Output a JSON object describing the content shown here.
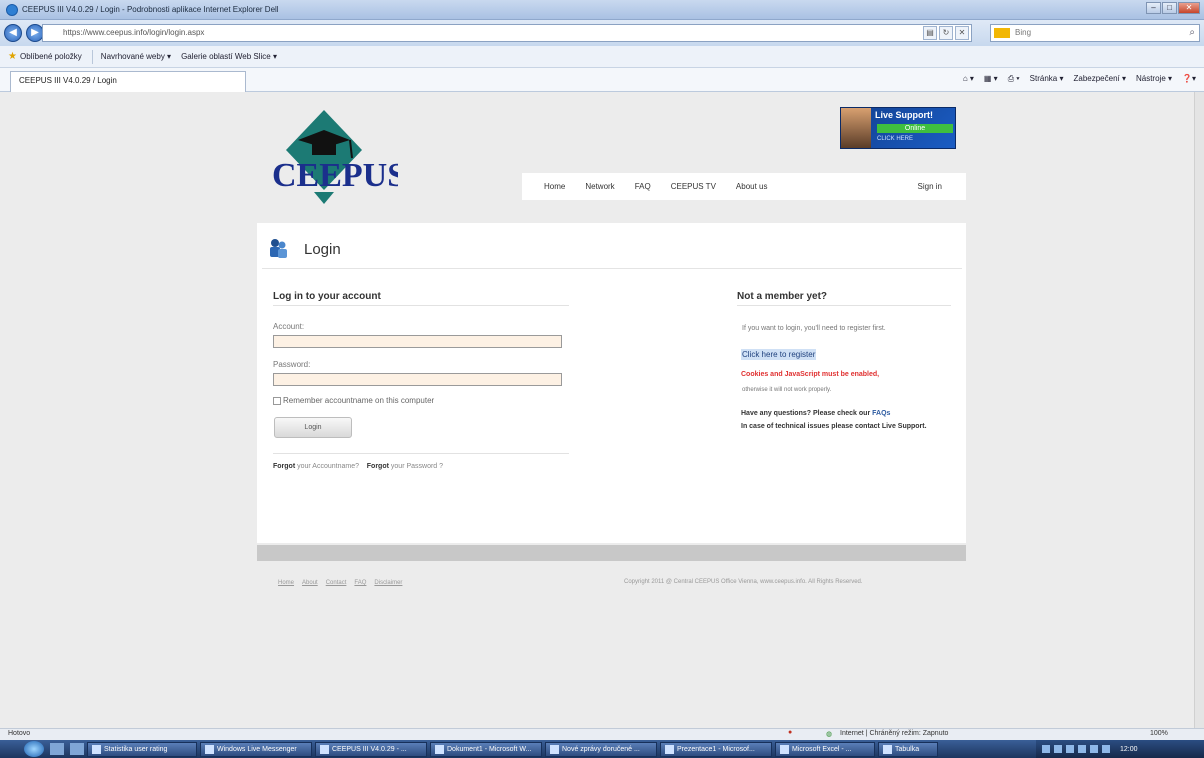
{
  "browser": {
    "window_title": "CEEPUS III V4.0.29 / Login - Podrobnosti aplikace Internet Explorer Dell",
    "url": "https://www.ceepus.info/login/login.aspx",
    "search_placeholder": "Bing",
    "favorites": {
      "label": "Oblíbené položky",
      "items": [
        "Navrhované weby ▾",
        "Galerie oblastí Web Slice ▾"
      ]
    },
    "tab_label": "CEEPUS III V4.0.29 / Login",
    "commands": [
      "Stránka ▾",
      "Zabezpečení ▾",
      "Nástroje ▾"
    ]
  },
  "header": {
    "logo_text": "CEEPUS",
    "live_support": {
      "title": "Live Support!",
      "status": "Online",
      "cta": "CLICK HERE"
    },
    "nav": [
      "Home",
      "Network",
      "FAQ",
      "CEEPUS TV",
      "About us"
    ],
    "sign_in": "Sign in"
  },
  "login": {
    "page_title": "Login",
    "section_title": "Log in to your account",
    "account_label": "Account:",
    "account_value": "",
    "password_label": "Password:",
    "password_value": "",
    "remember_label": "Remember accountname on this computer",
    "login_button": "Login",
    "forgot_account_bold": "Forgot",
    "forgot_account_text": "your Accountname?",
    "forgot_password_bold": "Forgot",
    "forgot_password_text": "your Password ?"
  },
  "register": {
    "section_title": "Not a member yet?",
    "intro": "If you want to login, you'll need to register first.",
    "link": "Click here to register",
    "cookie_warning": "Cookies and JavaScript must be enabled,",
    "cookie_note": "otherwise it will not work properly.",
    "questions_prefix": "Have any questions? Please check our",
    "questions_link": "FAQs",
    "questions_suffix": "In case of technical issues please contact Live Support."
  },
  "footer": {
    "links": [
      "Home",
      "About",
      "Contact",
      "FAQ",
      "Disclaimer"
    ],
    "copyright": "Copyright 2011 @ Central CEEPUS Office Vienna, www.ceepus.info. All Rights Reserved."
  },
  "statusbar": {
    "left": "Hotovo",
    "zone": "Internet | Chráněný režim: Zapnuto",
    "zoom": "100%"
  },
  "taskbar": {
    "items": [
      "Statistika user rating",
      "Windows Live Messenger",
      "CEEPUS III V4.0.29 - ...",
      "Dokument1 - Microsoft W...",
      "Nové zprávy doručené ...",
      "Prezentace1 - Microsof...",
      "Microsoft Excel - ...",
      "Tabulka"
    ],
    "time": "12:00"
  },
  "colors": {
    "accent_teal": "#1c7a74",
    "logo_blue": "#1b2f8c",
    "warning_red": "#e03030",
    "field_bg": "#fdf1e4"
  }
}
